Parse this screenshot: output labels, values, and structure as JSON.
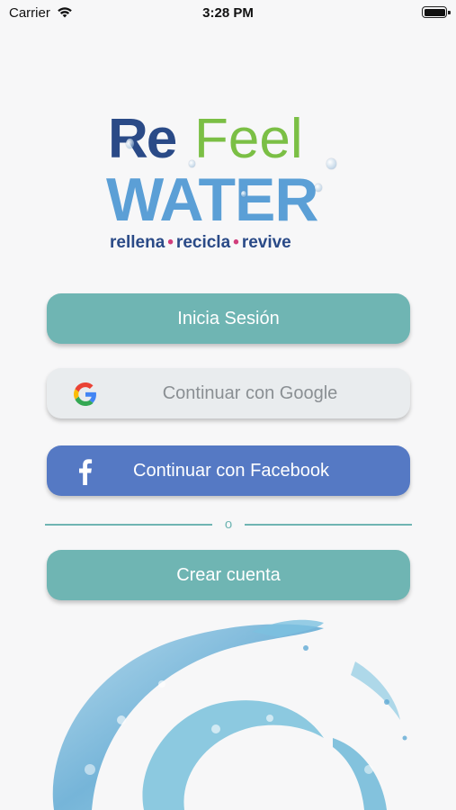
{
  "status_bar": {
    "carrier": "Carrier",
    "time": "3:28 PM"
  },
  "logo": {
    "re": "Re",
    "feel": "Feel",
    "water": "WATER",
    "tagline": [
      "rellena",
      "recicla",
      "revive"
    ],
    "colors": {
      "re": "#2a4a87",
      "feel": "#7bbf45",
      "water": "#5b9fd6",
      "dot": "#d13e7c"
    }
  },
  "buttons": {
    "login": "Inicia Sesión",
    "google": "Continuar con Google",
    "facebook": "Continuar con Facebook",
    "create": "Crear cuenta"
  },
  "divider": {
    "text": "o"
  },
  "icons": {
    "wifi": "wifi-icon",
    "battery": "battery-icon",
    "google": "google-icon",
    "facebook": "facebook-icon",
    "splash": "water-splash-image"
  },
  "colors": {
    "teal": "#6fb5b3",
    "facebook": "#5579c4",
    "google_bg": "#e9ecee",
    "background": "#f7f7f8"
  }
}
